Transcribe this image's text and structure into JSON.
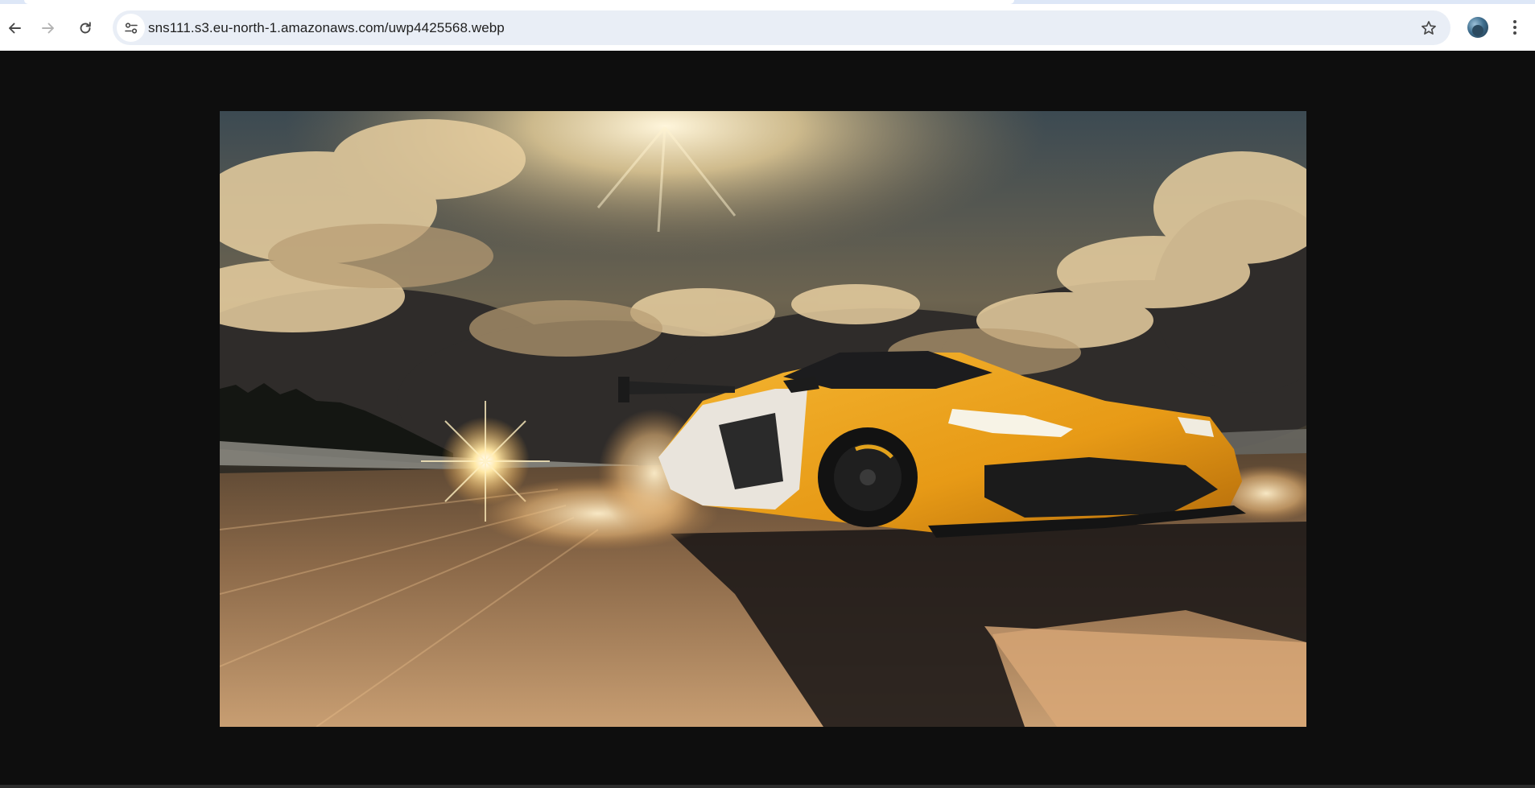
{
  "browser": {
    "url": "sns111.s3.eu-north-1.amazonaws.com/uwp4425568.webp",
    "icons": {
      "back": "arrow-left-icon",
      "forward": "arrow-right-icon",
      "reload": "reload-icon",
      "site_info": "tune-icon",
      "bookmark": "star-outline-icon",
      "menu": "three-dots-vertical-icon"
    },
    "forward_enabled": false
  },
  "colors": {
    "toolbar_bg": "#ffffff",
    "omnibox_bg": "#e9eef6",
    "viewer_bg": "#0e0e0e",
    "car_accent": "#e8a21c"
  },
  "content": {
    "type": "image",
    "subject": "car"
  }
}
